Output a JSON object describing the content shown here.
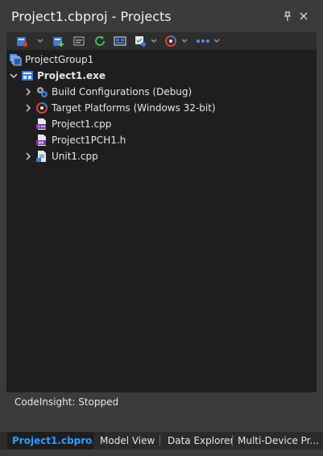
{
  "window": {
    "title": "Project1.cbproj - Projects",
    "pin_glyph": "📌",
    "close_glyph": "✕"
  },
  "toolbar": {
    "icons": [
      "project-options-icon",
      "add-new-icon",
      "add-existing-icon",
      "refresh-icon",
      "layout-icon",
      "build-icon",
      "platform-icon",
      "more-icon"
    ]
  },
  "tree": {
    "group": {
      "label": "ProjectGroup1",
      "icon": "project-group-icon"
    },
    "project": {
      "label": "Project1.exe",
      "icon": "exe-project-icon"
    },
    "children": [
      {
        "label": "Build Configurations (Debug)",
        "icon": "gears-icon",
        "expandable": true
      },
      {
        "label": "Target Platforms (Windows 32-bit)",
        "icon": "target-icon",
        "expandable": true
      },
      {
        "label": "Project1.cpp",
        "icon": "cpp-file-icon",
        "expandable": false
      },
      {
        "label": "Project1PCH1.h",
        "icon": "header-file-icon",
        "expandable": false
      },
      {
        "label": "Unit1.cpp",
        "icon": "unit-file-icon",
        "expandable": true
      }
    ]
  },
  "status": {
    "text": "CodeInsight: Stopped"
  },
  "tabs": [
    {
      "label": "Project1.cbpro...",
      "active": true
    },
    {
      "label": "Model View",
      "active": false
    },
    {
      "label": "Data Explorer",
      "active": false
    },
    {
      "label": "Multi-Device Pr...",
      "active": false
    }
  ],
  "colors": {
    "accent": "#2f9bff",
    "background": "#1e1e1e",
    "chrome": "#3b3b3b"
  }
}
